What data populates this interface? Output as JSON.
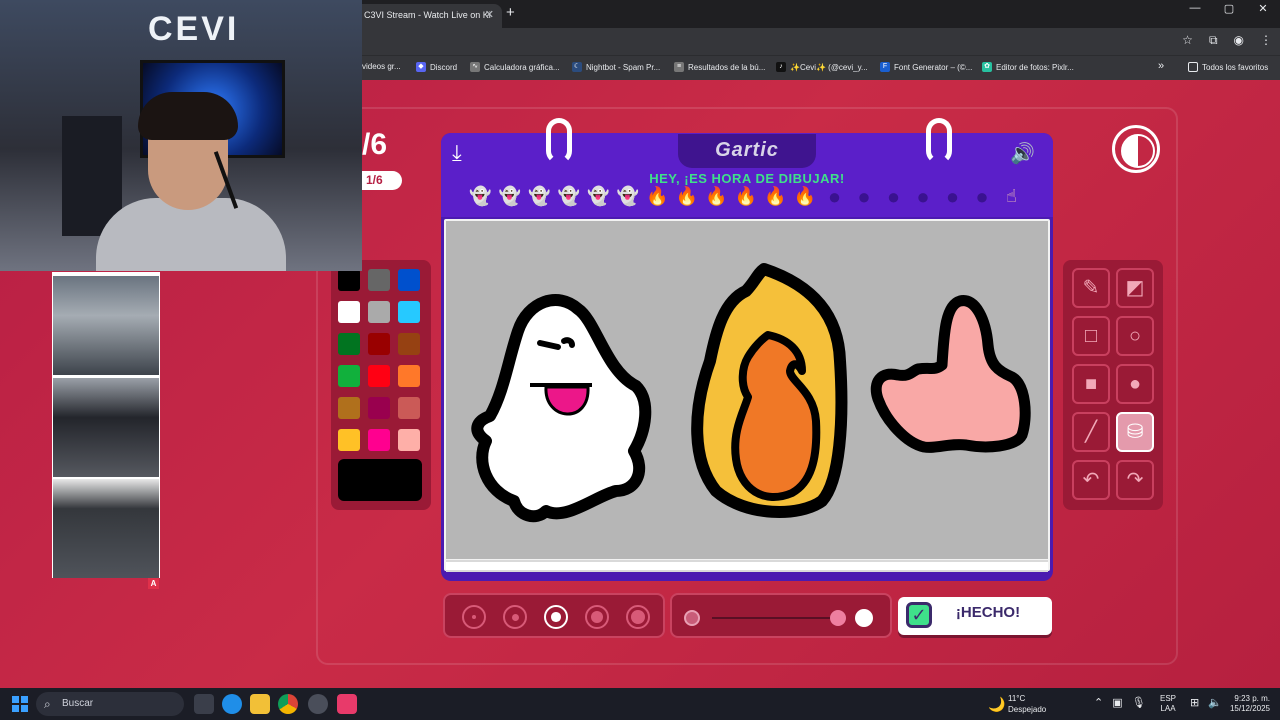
{
  "browser": {
    "tab_title": "C3VI Stream - Watch Live on Ki",
    "tab_close": "✕",
    "new_tab": "+",
    "window_controls": [
      "—",
      "▢",
      "✕"
    ],
    "bookmarks": [
      {
        "label": "videos gr...",
        "icon": "video-icon",
        "color": "#555"
      },
      {
        "label": "Discord",
        "icon": "discord-icon",
        "color": "#5865f2"
      },
      {
        "label": "Calculadora gráfica...",
        "icon": "graph-icon",
        "color": "#888"
      },
      {
        "label": "Nightbot - Spam Pr...",
        "icon": "nightbot-icon",
        "color": "#2b4c7e"
      },
      {
        "label": "Resultados de la bú...",
        "icon": "doc-icon",
        "color": "#777"
      },
      {
        "label": "✨Cevi✨ (@cevi_y...",
        "icon": "tiktok-icon",
        "color": "#111"
      },
      {
        "label": "Font Generator – (©...",
        "icon": "font-icon",
        "color": "#1a5fd0"
      },
      {
        "label": "Editor de fotos: Pixlr...",
        "icon": "pixlr-icon",
        "color": "#27c1a0"
      }
    ],
    "bookmarks_overflow": "»",
    "all_bookmarks": "Todos los favoritos"
  },
  "game": {
    "round_fraction": "/6",
    "round_pill": "1/6",
    "logo": "Gartic",
    "headline": "HEY, ¡ES HORA DE DIBUJAR!",
    "timeline": [
      {
        "icon": "ghost-icon",
        "glyph": "👻"
      },
      {
        "icon": "ghost-icon",
        "glyph": "👻"
      },
      {
        "icon": "ghost-icon",
        "glyph": "👻"
      },
      {
        "icon": "ghost-icon",
        "glyph": "👻"
      },
      {
        "icon": "ghost-icon",
        "glyph": "👻"
      },
      {
        "icon": "ghost-icon",
        "glyph": "👻"
      },
      {
        "icon": "fire-icon",
        "glyph": "🔥"
      },
      {
        "icon": "fire-icon",
        "glyph": "🔥"
      },
      {
        "icon": "fire-icon",
        "glyph": "🔥"
      },
      {
        "icon": "fire-icon",
        "glyph": "🔥"
      },
      {
        "icon": "fire-icon",
        "glyph": "🔥"
      },
      {
        "icon": "fire-icon",
        "glyph": "🔥"
      },
      {
        "icon": "ghost-dim-icon",
        "glyph": "●"
      },
      {
        "icon": "ghost-dim-icon",
        "glyph": "●"
      },
      {
        "icon": "ghost-dim-icon",
        "glyph": "●"
      },
      {
        "icon": "ghost-dim-icon",
        "glyph": "●"
      },
      {
        "icon": "ghost-dim-icon",
        "glyph": "●"
      },
      {
        "icon": "ghost-dim-icon",
        "glyph": "●"
      },
      {
        "icon": "hand-icon",
        "glyph": "☝"
      }
    ],
    "palette": [
      "#000000",
      "#666666",
      "#0050cd",
      "#ffffff",
      "#aaaaaa",
      "#26c9ff",
      "#017420",
      "#990000",
      "#964112",
      "#11b03c",
      "#ff0013",
      "#ff7829",
      "#b0701c",
      "#99004e",
      "#cb5a57",
      "#ffc126",
      "#ff008f",
      "#feafa8"
    ],
    "current_color": "#000000",
    "tools": [
      {
        "name": "pencil-tool",
        "glyph": "✎"
      },
      {
        "name": "eraser-tool",
        "glyph": "◩"
      },
      {
        "name": "rectangle-tool",
        "glyph": "□"
      },
      {
        "name": "ellipse-tool",
        "glyph": "○"
      },
      {
        "name": "filled-rectangle-tool",
        "glyph": "■"
      },
      {
        "name": "filled-ellipse-tool",
        "glyph": "●"
      },
      {
        "name": "line-tool",
        "glyph": "╱"
      },
      {
        "name": "fill-tool",
        "glyph": "⛁"
      },
      {
        "name": "undo-tool",
        "glyph": "↶"
      },
      {
        "name": "redo-tool",
        "glyph": "↷"
      }
    ],
    "active_tool": "fill-tool",
    "brush_sizes": [
      1,
      2,
      3,
      4,
      5
    ],
    "selected_brush_size": 3,
    "opacity_level": 1.0,
    "done_label": "¡HECHO!",
    "done_check": "✓"
  },
  "stream_overlay": {
    "webcam_logo": "CEVI",
    "photo_badge": "A"
  },
  "taskbar": {
    "search_placeholder": "Buscar",
    "weather_temp": "11°C",
    "weather_desc": "Despejado",
    "language_top": "ESP",
    "language_bottom": "LAA",
    "time": "9:23 p. m.",
    "date": "15/12/2025"
  }
}
